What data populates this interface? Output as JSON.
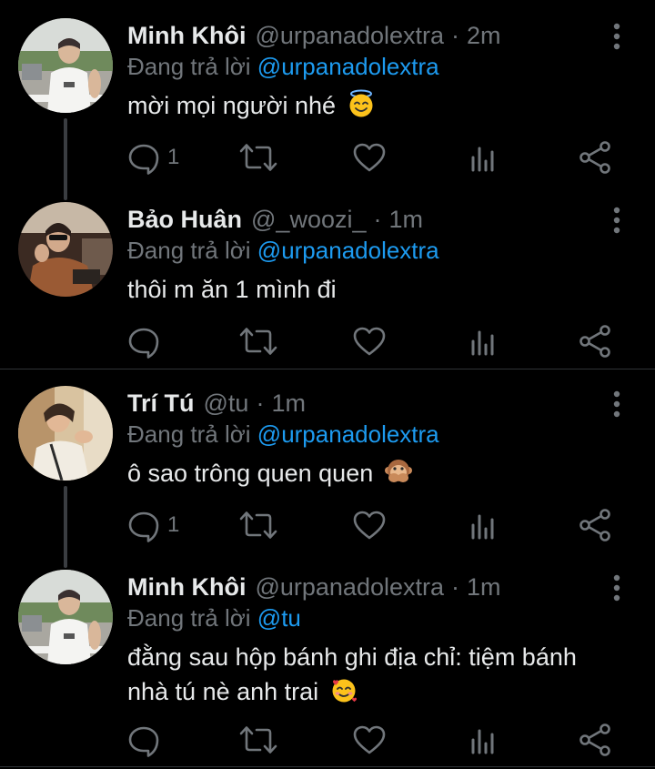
{
  "colors": {
    "background": "#000000",
    "text": "#e7e9ea",
    "muted": "#71767b",
    "link": "#1d9bf0",
    "divider": "#2f3336",
    "thread_line": "#3a3d41"
  },
  "tweets": [
    {
      "name": "Minh Khôi",
      "handle": "@urpanadolextra",
      "separator": "·",
      "time": "2m",
      "replying_prefix": "Đang trả lời",
      "replying_to": "@urpanadolextra",
      "text": "mời mọi người nhé",
      "emoji": "😇",
      "reply_count": "1",
      "icons": [
        "reply-icon",
        "retweet-icon",
        "like-icon",
        "views-icon",
        "share-icon",
        "more-icon"
      ]
    },
    {
      "name": "Bảo Huân",
      "handle": "@_woozi_",
      "separator": "·",
      "time": "1m",
      "replying_prefix": "Đang trả lời",
      "replying_to": "@urpanadolextra",
      "text": "thôi m ăn 1 mình đi",
      "emoji": "",
      "reply_count": "",
      "icons": [
        "reply-icon",
        "retweet-icon",
        "like-icon",
        "views-icon",
        "share-icon",
        "more-icon"
      ]
    },
    {
      "name": "Trí Tú",
      "handle": "@tu",
      "separator": "·",
      "time": "1m",
      "replying_prefix": "Đang trả lời",
      "replying_to": "@urpanadolextra",
      "text": "ô sao trông quen quen",
      "emoji": "🙊",
      "reply_count": "1",
      "icons": [
        "reply-icon",
        "retweet-icon",
        "like-icon",
        "views-icon",
        "share-icon",
        "more-icon"
      ]
    },
    {
      "name": "Minh Khôi",
      "handle": "@urpanadolextra",
      "separator": "·",
      "time": "1m",
      "replying_prefix": "Đang trả lời",
      "replying_to": "@tu",
      "text": "đằng sau hộp bánh ghi địa chỉ: tiệm bánh nhà tú nè anh trai",
      "emoji": "🥰",
      "reply_count": "",
      "icons": [
        "reply-icon",
        "retweet-icon",
        "like-icon",
        "views-icon",
        "share-icon",
        "more-icon"
      ]
    }
  ]
}
